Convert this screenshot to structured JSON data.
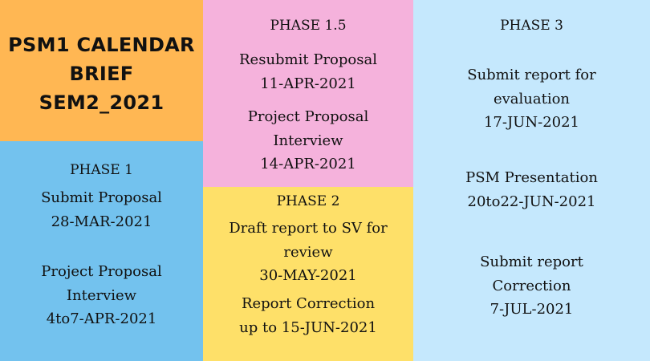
{
  "title": "PSM1 CALENDAR\nBRIEF\nSEM2_2021",
  "phase_1": {
    "heading": "PHASE 1",
    "items": [
      "Submit Proposal\n28-MAR-2021",
      "Project Proposal\nInterview\n4to7-APR-2021"
    ]
  },
  "phase_1_5": {
    "heading": "PHASE 1.5",
    "items": [
      "Resubmit Proposal\n11-APR-2021",
      "Project Proposal\nInterview\n14-APR-2021"
    ]
  },
  "phase_2": {
    "heading": "PHASE 2",
    "items": [
      "Draft report to SV for\nreview\n30-MAY-2021",
      "Report Correction\nup to 15-JUN-2021"
    ]
  },
  "phase_3": {
    "heading": "PHASE 3",
    "items": [
      "Submit report for\nevaluation\n17-JUN-2021",
      "PSM Presentation\n20to22-JUN-2021",
      "Submit report\nCorrection\n7-JUL-2021"
    ]
  },
  "colors": {
    "title_panel": "#ffb753",
    "phase_1": "#73c2ee",
    "phase_1_5": "#f5b2dc",
    "phase_2": "#fee069",
    "phase_3": "#c5e8fd"
  }
}
